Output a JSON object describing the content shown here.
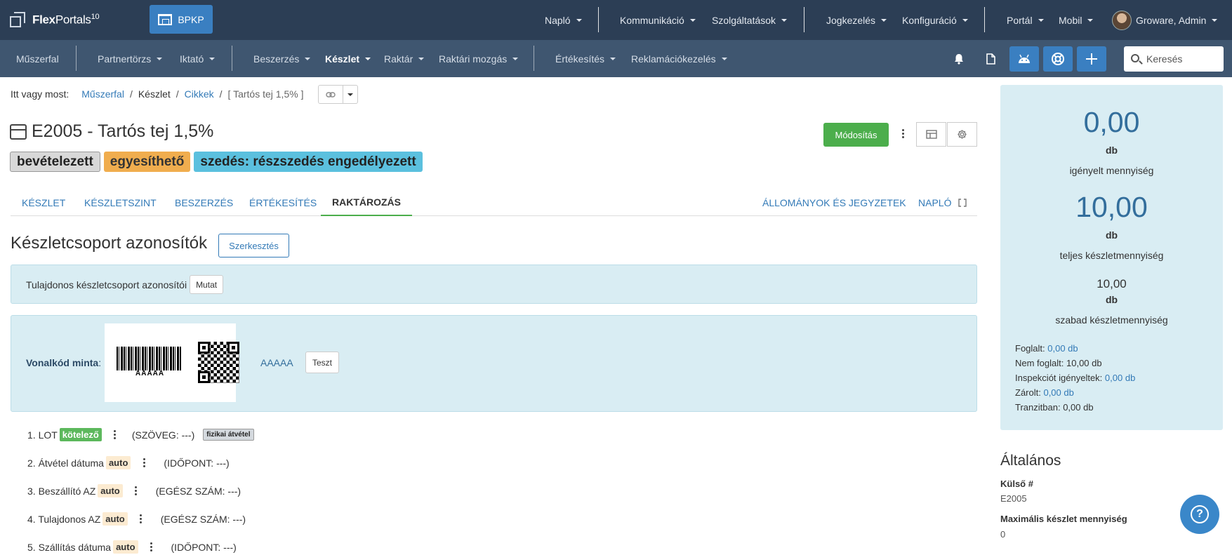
{
  "app": {
    "brand_bold": "Flex",
    "brand_light": "Portals",
    "brand_version": "10",
    "workspace_button": "BPKP"
  },
  "topnav": {
    "items": [
      "Napló",
      "Kommunikáció",
      "Szolgáltatások",
      "Jogkezelés",
      "Konfiguráció",
      "Portál",
      "Mobil"
    ],
    "user": "Groware, Admin"
  },
  "subnav": {
    "items": [
      "Műszerfal",
      "Partnertörzs",
      "Iktató",
      "Beszerzés",
      "Készlet",
      "Raktár",
      "Raktári mozgás",
      "Értékesítés",
      "Reklamációkezelés"
    ],
    "active": "Készlet",
    "search_placeholder": "Keresés"
  },
  "breadcrumb": {
    "prefix": "Itt vagy most:",
    "items": [
      "Műszerfal",
      "Készlet",
      "Cikkek",
      "[ Tartós tej 1,5% ]"
    ]
  },
  "item": {
    "title": "E2005 - Tartós tej 1,5%",
    "badges": [
      "bevételezett",
      "egyesíthető",
      "szedés: részszedés engedélyezett"
    ],
    "edit_button": "Módosítás"
  },
  "tabs": {
    "left": [
      "Készlet",
      "Készletszint",
      "Beszerzés",
      "Értékesítés",
      "Raktározás"
    ],
    "right": [
      "Állományok és jegyzetek",
      "Napló"
    ],
    "active": "Raktározás"
  },
  "section": {
    "title": "Készletcsoport azonosítók",
    "edit_button": "Szerkesztés",
    "owner_label": "Tulajdonos készletcsoport azonosítói",
    "show_button": "Mutat",
    "barcode_label": "Vonalkód minta",
    "barcode_value": "AAAAA",
    "barcode_text": "AAAAA",
    "test_button": "Teszt"
  },
  "attributes": [
    {
      "label": "1. LOT",
      "tag": "kötelező",
      "type": "(SZÖVEG: ---)",
      "extra": "fizikai átvétel"
    },
    {
      "label": "2. Átvétel dátuma",
      "tag": "auto",
      "type": "(IDŐPONT: ---)"
    },
    {
      "label": "3. Beszállító AZ",
      "tag": "auto",
      "type": "(EGÉSZ SZÁM: ---)"
    },
    {
      "label": "4. Tulajdonos AZ",
      "tag": "auto",
      "type": "(EGÉSZ SZÁM: ---)"
    },
    {
      "label": "5. Szállítás dátuma",
      "tag": "auto",
      "type": "(IDŐPONT: ---)"
    }
  ],
  "stock": {
    "requested_value": "0,00",
    "requested_unit": "db",
    "requested_label": "igényelt mennyiség",
    "total_value": "10,00",
    "total_unit": "db",
    "total_label": "teljes készletmennyiség",
    "free_value": "10,00",
    "free_unit": "db",
    "free_label": "szabad készletmennyiség",
    "details": {
      "reserved_label": "Foglalt:",
      "reserved_value": "0,00 db",
      "unreserved_label": "Nem foglalt:",
      "unreserved_value": "10,00 db",
      "inspection_label": "Inspekciót igényeltek:",
      "inspection_value": "0,00 db",
      "locked_label": "Zárolt:",
      "locked_value": "0,00 db",
      "transit_label": "Tranzitban:",
      "transit_value": "0,00 db"
    }
  },
  "general": {
    "title": "Általános",
    "external_label": "Külső #",
    "external_value": "E2005",
    "max_label": "Maximális készlet mennyiség",
    "max_value": "0"
  },
  "colors": {
    "topbar": "#2c3e55",
    "subbar": "#3f5670",
    "accent": "#3a7fc1",
    "success": "#4cae4c",
    "info_bg": "#d9edf3"
  }
}
